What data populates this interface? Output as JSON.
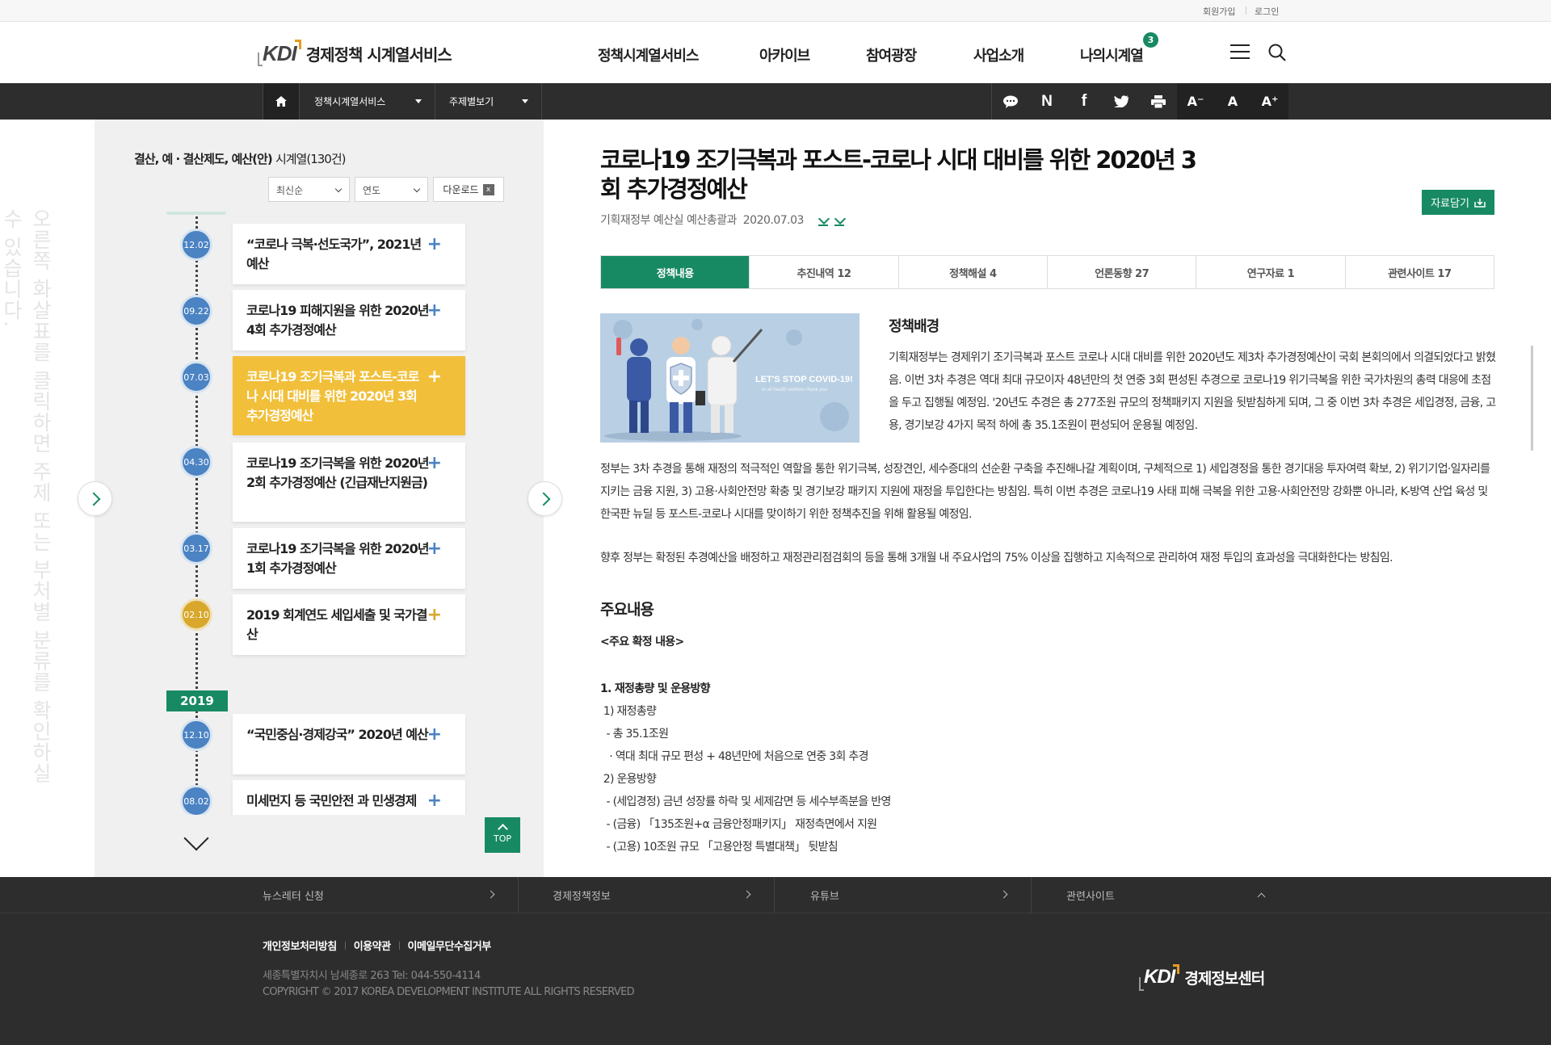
{
  "utility": {
    "signup": "회원가입",
    "login": "로그인"
  },
  "header": {
    "logo_mark": "KDI",
    "logo_text": "경제정책 시계열서비스",
    "nav": [
      "정책시계열서비스",
      "아카이브",
      "참여광장",
      "사업소개",
      "나의시계열"
    ],
    "badge": "3"
  },
  "navbar": {
    "crumb1": "정책시계열서비스",
    "crumb2": "주제별보기",
    "share_icons": [
      "speech-bubble-icon",
      "naver-icon",
      "facebook-icon",
      "twitter-icon",
      "print-icon"
    ],
    "font_small": "A⁻",
    "font_normal": "A",
    "font_large": "A⁺"
  },
  "left": {
    "side_hint": "오른쪽 화살표를 클릭하면 주제 또는 부처별 분류를 확인하실 수 있습니다.",
    "title": "결산, 예 · 결산제도, 예산(안)",
    "title_suffix": "시계열(130건)",
    "sort_select": "최신순",
    "year_select": "연도",
    "download": "다운로드",
    "year_badge": "2019",
    "top": "TOP",
    "items": [
      {
        "date": "12.02",
        "title": "“코로나 극복·선도국가”, 2021년 예산"
      },
      {
        "date": "09.22",
        "title": "코로나19 피해지원을 위한 2020년 4회 추가경정예산"
      },
      {
        "date": "07.03",
        "title": "코로나19 조기극복과 포스트-코로나 시대 대비를 위한 2020년 3회 추가경정예산"
      },
      {
        "date": "04.30",
        "title": "코로나19 조기극복을 위한 2020년 2회 추가경정예산 (긴급재난지원금)"
      },
      {
        "date": "03.17",
        "title": "코로나19 조기극복을 위한 2020년 1회 추가경정예산"
      },
      {
        "date": "02.10",
        "title": "2019 회계연도 세입세출 및 국가결산"
      },
      {
        "date": "12.10",
        "title": "“국민중심·경제강국” 2020년 예산"
      },
      {
        "date": "08.02",
        "title": "미세먼지 등 국민안전 과 민생경제"
      }
    ]
  },
  "content": {
    "title": "코로나19 조기극복과 포스트-코로나 시대 대비를 위한 2020년 3회 추가경정예산",
    "agency": "기획재정부 예산실 예산총괄과",
    "date": "2020.07.03",
    "save": "자료담기",
    "tabs": [
      "정책내용",
      "추진내역 12",
      "정책해설 4",
      "언론동향 27",
      "연구자료 1",
      "관련사이트 17"
    ],
    "image_caption": "LET'S STOP COVID-19!",
    "image_subcaption": "to all health workers thank you",
    "bg_heading": "정책배경",
    "bg_text": "기획재정부는 경제위기 조기극복과 포스트 코로나 시대 대비를 위한 2020년도 제3차 추가경정예산이 국회 본회의에서 의결되었다고 밝혔음. 이번 3차 추경은 역대 최대 규모이자 48년만의 첫 연중 3회 편성된 추경으로 코로나19 위기극복을 위한 국가차원의 총력 대응에 초점을 두고 집행될 예정임. '20년도 추경은 총 277조원 규모의 정책패키지 지원을 뒷받침하게 되며, 그 중 이번 3차 추경은 세입경정, 금융, 고용, 경기보강 4가지 목적 하에 총 35.1조원이 편성되어 운용될 예정임.",
    "para2": "정부는 3차 추경을 통해 재정의 적극적인 역할을 통한 위기극복, 성장견인, 세수증대의 선순환 구축을 추진해나갈 계획이며, 구체적으로 1) 세입경정을 통한 경기대응 투자여력 확보, 2) 위기기업·일자리를 지키는 금융 지원, 3) 고용·사회안전망 확충 및 경기보강 패키지 지원에 재정을 투입한다는 방침임. 특히 이번 추경은 코로나19 사태 피해 극복을 위한 고용·사회안전망 강화뿐 아니라, K-방역 산업 육성 및 한국판 뉴딜 등 포스트-코로나 시대를 맞이하기 위한 정책추진을 위해 활용될 예정임.",
    "para3": "향후 정부는 확정된 추경예산을 배정하고 재정관리점검회의 등을 통해 3개월 내 주요사업의 75% 이상을 집행하고 지속적으로 관리하여 재정 투입의 효과성을 극대화한다는 방침임.",
    "main_heading": "주요내용",
    "sub_heading": "<주요 확정 내용>",
    "list": [
      "1. 재정총량 및 운용방향",
      " 1) 재정총량",
      "  - 총 35.1조원",
      "   · 역대 최대 규모 편성 + 48년만에 처음으로 연중 3회 추경",
      " 2) 운용방향",
      "  - (세입경정) 금년 성장률 하락 및 세제감면 등 세수부족분을 반영",
      "  - (금융) 「135조원+α 금융안정패키지」 재정측면에서 지원",
      "  - (고용) 10조원 규모 「고용안정 특별대책」 뒷받침"
    ]
  },
  "footnav": [
    "뉴스레터 신청",
    "경제정책정보",
    "유튜브",
    "관련사이트"
  ],
  "footer": {
    "links": [
      "개인정보처리방침",
      "이용약관",
      "이메일무단수집거부"
    ],
    "address": "세종특별자치시 남세종로 263 Tel: 044-550-4114",
    "copyright": "COPYRIGHT © 2017 KOREA DEVELOPMENT INSTITUTE ALL RIGHTS RESERVED",
    "logo_mark": "KDI",
    "logo_text": "경제정보센터"
  }
}
